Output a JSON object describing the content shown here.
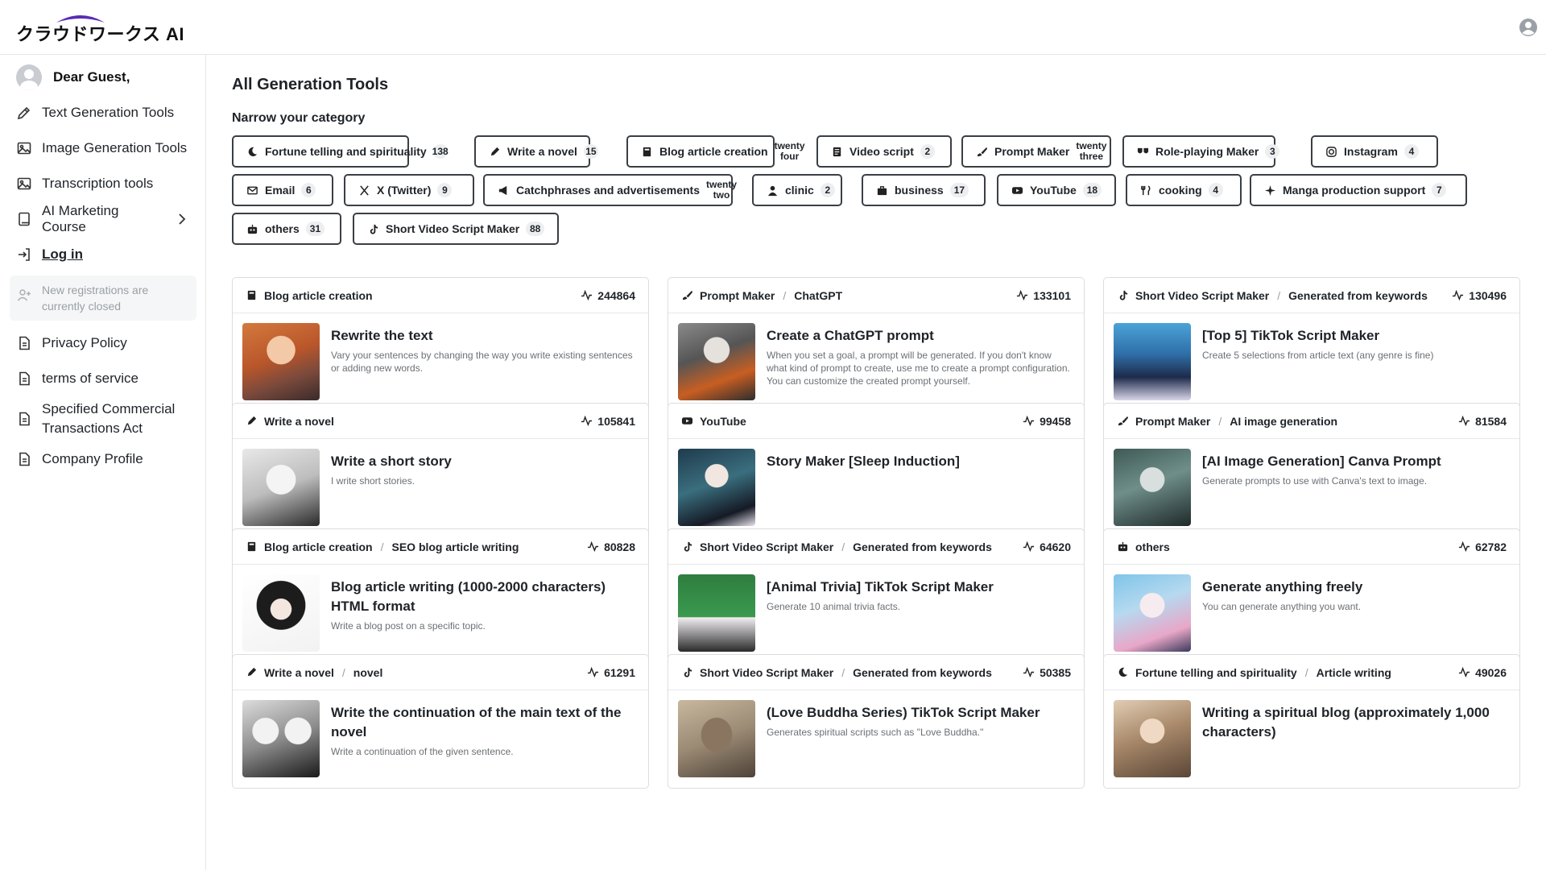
{
  "header": {
    "logo_text": "クラウドワークス AI"
  },
  "sidebar": {
    "greeting": "Dear Guest,",
    "items": [
      {
        "label": "Text Generation Tools"
      },
      {
        "label": "Image Generation Tools"
      },
      {
        "label": "Transcription tools"
      },
      {
        "label": "AI Marketing Course"
      },
      {
        "label": "Log in"
      }
    ],
    "notice": "New registrations are currently closed",
    "footer_items": [
      {
        "label": "Privacy Policy"
      },
      {
        "label": "terms of service"
      },
      {
        "label": "Specified Commercial Transactions Act"
      },
      {
        "label": "Company Profile"
      }
    ]
  },
  "main": {
    "title": "All Generation Tools",
    "narrow_label": "Narrow your category",
    "categories": [
      {
        "label": "Fortune telling and spirituality",
        "count": "138",
        "icon": "moon-icon"
      },
      {
        "label": "Write a novel",
        "count": "15",
        "icon": "pen-icon"
      },
      {
        "label": "Blog article creation",
        "count": "twenty four",
        "icon": "book-icon"
      },
      {
        "label": "Video script",
        "count": "2",
        "icon": "script-icon"
      },
      {
        "label": "Prompt Maker",
        "count": "twenty three",
        "icon": "brush-icon"
      },
      {
        "label": "Role-playing Maker",
        "count": "3",
        "icon": "masks-icon"
      },
      {
        "label": "Instagram",
        "count": "4",
        "icon": "instagram-icon"
      },
      {
        "label": "Email",
        "count": "6",
        "icon": "mail-icon"
      },
      {
        "label": "X (Twitter)",
        "count": "9",
        "icon": "x-icon"
      },
      {
        "label": "Catchphrases and advertisements",
        "count": "twenty two",
        "icon": "megaphone-icon"
      },
      {
        "label": "clinic",
        "count": "2",
        "icon": "doctor-icon"
      },
      {
        "label": "business",
        "count": "17",
        "icon": "briefcase-icon"
      },
      {
        "label": "YouTube",
        "count": "18",
        "icon": "youtube-icon"
      },
      {
        "label": "cooking",
        "count": "4",
        "icon": "utensils-icon"
      },
      {
        "label": "Manga production support",
        "count": "7",
        "icon": "sparkle-icon"
      },
      {
        "label": "others",
        "count": "31",
        "icon": "robot-icon"
      },
      {
        "label": "Short Video Script Maker",
        "count": "88",
        "icon": "tiktok-icon"
      }
    ],
    "cards": [
      {
        "category": "Blog article creation",
        "sub": "",
        "views": "244864",
        "icon": "book-icon",
        "title": "Rewrite the text",
        "desc": "Vary your sentences by changing the way you write existing sentences or adding new words."
      },
      {
        "category": "Prompt Maker",
        "sub": "ChatGPT",
        "views": "133101",
        "icon": "brush-icon",
        "title": "Create a ChatGPT prompt",
        "desc": "When you set a goal, a prompt will be generated. If you don't know what kind of prompt to create, use me to create a prompt configuration. You can customize the created prompt yourself."
      },
      {
        "category": "Short Video Script Maker",
        "sub": "Generated from keywords",
        "views": "130496",
        "icon": "tiktok-icon",
        "title": "[Top 5] TikTok Script Maker",
        "desc": "Create 5 selections from article text (any genre is fine)"
      },
      {
        "category": "Write a novel",
        "sub": "",
        "views": "105841",
        "icon": "pen-icon",
        "title": "Write a short story",
        "desc": "I write short stories."
      },
      {
        "category": "YouTube",
        "sub": "",
        "views": "99458",
        "icon": "youtube-icon",
        "title": "Story Maker [Sleep Induction]",
        "desc": ""
      },
      {
        "category": "Prompt Maker",
        "sub": "AI image generation",
        "views": "81584",
        "icon": "brush-icon",
        "title": "[AI Image Generation] Canva Prompt",
        "desc": "Generate prompts to use with Canva's text to image."
      },
      {
        "category": "Blog article creation",
        "sub": "SEO blog article writing",
        "views": "80828",
        "icon": "book-icon",
        "title": "Blog article writing (1000-2000 characters) HTML format",
        "desc": "Write a blog post on a specific topic."
      },
      {
        "category": "Short Video Script Maker",
        "sub": "Generated from keywords",
        "views": "64620",
        "icon": "tiktok-icon",
        "title": "[Animal Trivia] TikTok Script Maker",
        "desc": "Generate 10 animal trivia facts."
      },
      {
        "category": "others",
        "sub": "",
        "views": "62782",
        "icon": "robot-icon",
        "title": "Generate anything freely",
        "desc": "You can generate anything you want."
      },
      {
        "category": "Write a novel",
        "sub": "novel",
        "views": "61291",
        "icon": "pen-icon",
        "title": "Write the continuation of the main text of the novel",
        "desc": "Write a continuation of the given sentence."
      },
      {
        "category": "Short Video Script Maker",
        "sub": "Generated from keywords",
        "views": "50385",
        "icon": "tiktok-icon",
        "title": "(Love Buddha Series) TikTok Script Maker",
        "desc": "Generates spiritual scripts such as \"Love Buddha.\""
      },
      {
        "category": "Fortune telling and spirituality",
        "sub": "Article writing",
        "views": "49026",
        "icon": "moon-icon",
        "title": "Writing a spiritual blog (approximately 1,000 characters)",
        "desc": ""
      }
    ]
  },
  "colors": {
    "border_dark": "#3a3f45",
    "text": "#1f2328",
    "muted": "#6b7075",
    "logo_arc": "#5b2bb5"
  }
}
